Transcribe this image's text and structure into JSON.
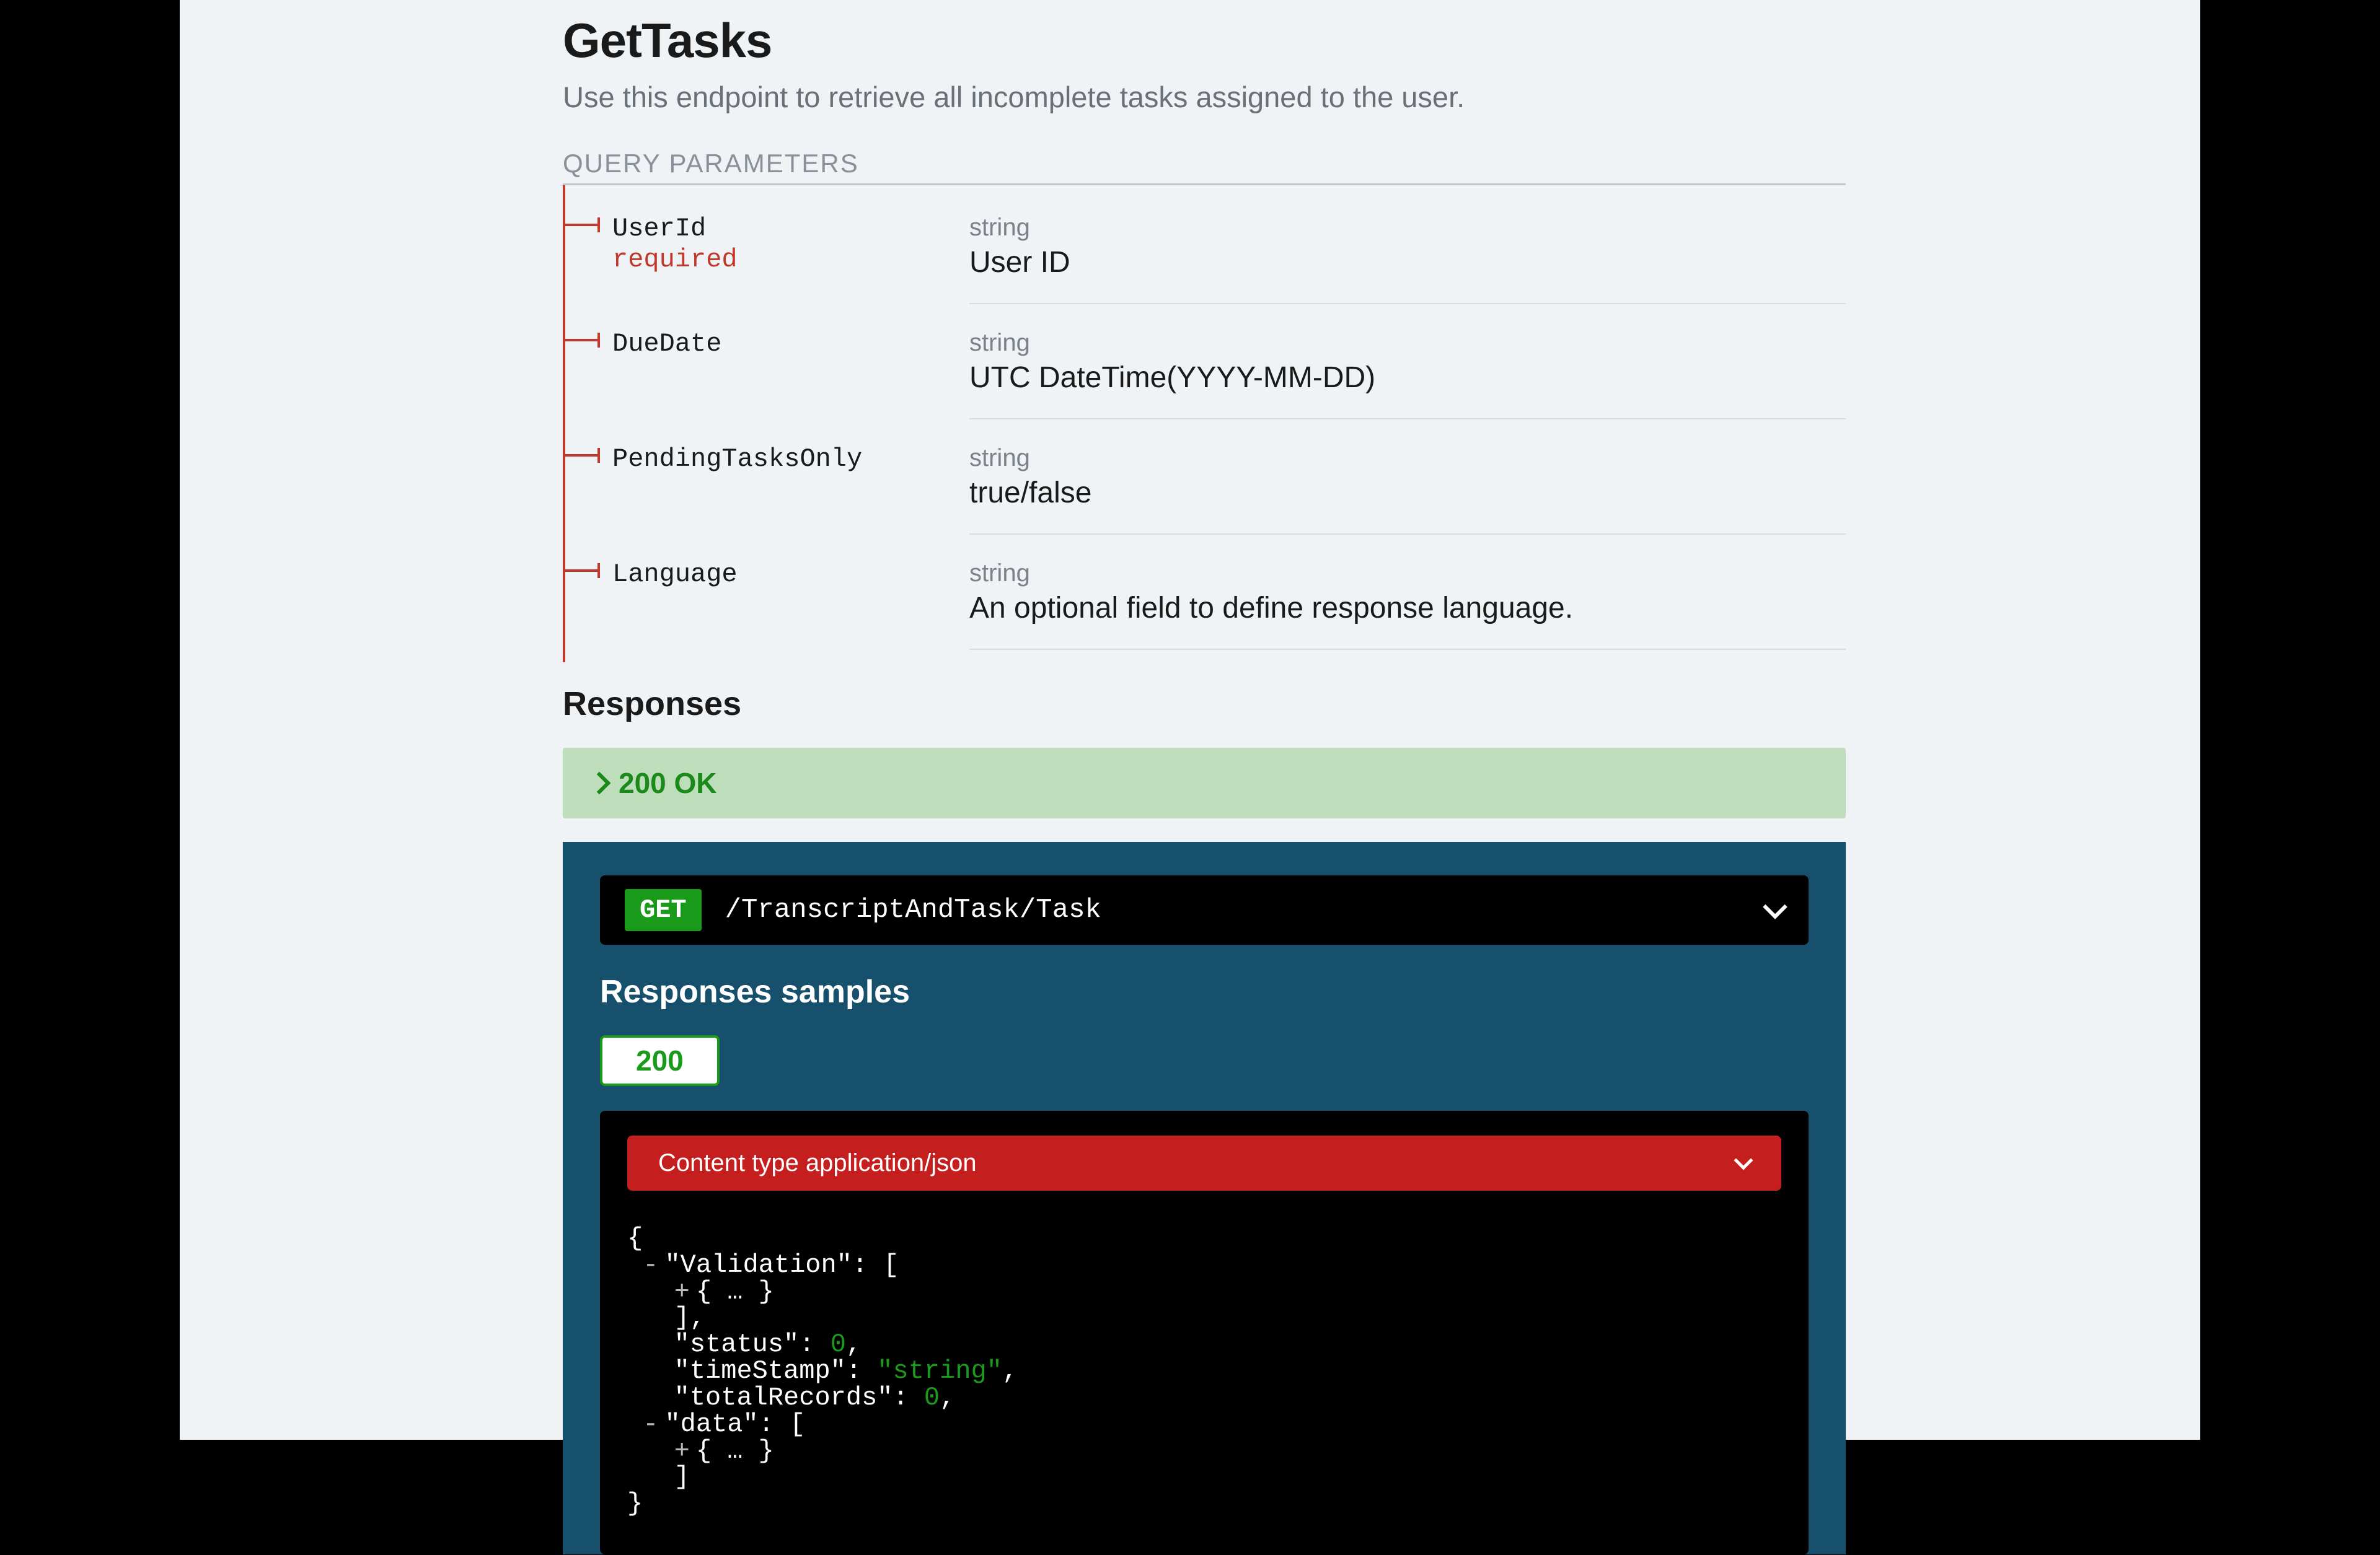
{
  "title": "GetTasks",
  "description": "Use this endpoint to retrieve all incomplete tasks assigned to the user.",
  "query_params_label": "QUERY PARAMETERS",
  "params": [
    {
      "name": "UserId",
      "required": true,
      "required_label": "required",
      "type": "string",
      "desc": "User ID"
    },
    {
      "name": "DueDate",
      "required": false,
      "type": "string",
      "desc": "UTC DateTime(YYYY-MM-DD)"
    },
    {
      "name": "PendingTasksOnly",
      "required": false,
      "type": "string",
      "desc": "true/false"
    },
    {
      "name": "Language",
      "required": false,
      "type": "string",
      "desc": "An optional field to define response language."
    }
  ],
  "responses_heading": "Responses",
  "response_200_label": "200 OK",
  "endpoint": {
    "method": "GET",
    "path": "/TranscriptAndTask/Task"
  },
  "samples_title": "Responses samples",
  "tab_200": "200",
  "content_type_label": "Content type application/json",
  "json_sample": {
    "keys": {
      "validation": "\"Validation\"",
      "status": "\"status\"",
      "timeStamp": "\"timeStamp\"",
      "totalRecords": "\"totalRecords\"",
      "data": "\"data\""
    },
    "vals": {
      "zero1": "0",
      "zero2": "0",
      "string": "\"string\""
    },
    "ellipsis": "{ … }"
  }
}
